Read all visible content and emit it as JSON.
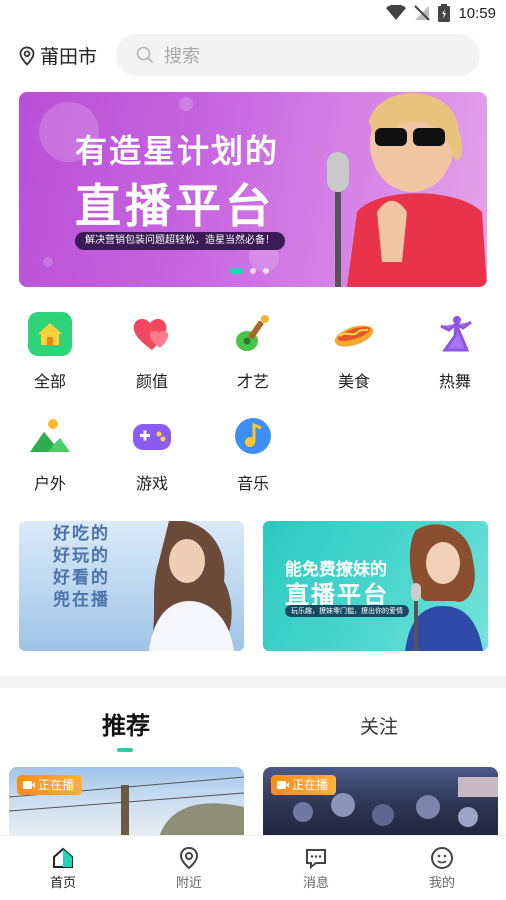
{
  "status_bar": {
    "time": "10:59"
  },
  "header": {
    "location": "莆田市",
    "search_placeholder": "搜索"
  },
  "banner": {
    "title_line1": "有造星计划的",
    "title_line2": "直播平台",
    "subtitle": "解决营销包装问题超轻松，造星当然必备！",
    "dots_count": 3,
    "active_dot": 0
  },
  "categories": [
    {
      "label": "全部",
      "icon": "home-icon"
    },
    {
      "label": "颜值",
      "icon": "heart-icon"
    },
    {
      "label": "才艺",
      "icon": "guitar-icon"
    },
    {
      "label": "美食",
      "icon": "hotdog-icon"
    },
    {
      "label": "热舞",
      "icon": "dancer-icon"
    },
    {
      "label": "户外",
      "icon": "mountain-icon"
    },
    {
      "label": "游戏",
      "icon": "gamepad-icon"
    },
    {
      "label": "音乐",
      "icon": "music-note-icon"
    }
  ],
  "promos": {
    "left": {
      "lines": [
        "好吃的",
        "好玩的",
        "好看的",
        "兜在播"
      ]
    },
    "right": {
      "line1": "能免费撩妹的",
      "line2": "直播平台",
      "subtitle": "玩乐趣，撩妹零门槛，撩出你的爱情"
    }
  },
  "tabs": {
    "recommend": "推荐",
    "follow": "关注"
  },
  "live_cards": [
    {
      "badge": "正在播"
    },
    {
      "badge": "正在播"
    }
  ],
  "bottom_nav": [
    {
      "label": "首页",
      "icon": "home-nav-icon",
      "active": true
    },
    {
      "label": "附近",
      "icon": "location-nav-icon",
      "active": false
    },
    {
      "label": "消息",
      "icon": "message-nav-icon",
      "active": false
    },
    {
      "label": "我的",
      "icon": "profile-nav-icon",
      "active": false
    }
  ],
  "colors": {
    "accent": "#22d4b8",
    "live_badge": "#ff8a1f",
    "banner": "#c766e0"
  }
}
